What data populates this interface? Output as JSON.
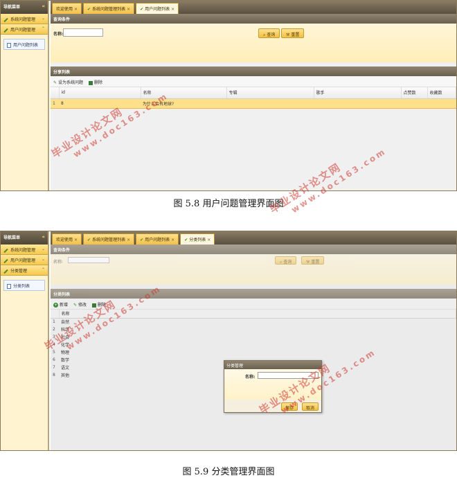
{
  "figure1": {
    "caption": "图 5.8 用户问题管理界面图",
    "sidebar": {
      "title": "导航菜单",
      "groups": [
        "系统问题管理",
        "用户问题管理"
      ],
      "items": [
        "用户问题列表"
      ]
    },
    "tabs": [
      "欢迎使用",
      "系统问题管理列表",
      "用户问题列表"
    ],
    "query": {
      "header": "查询条件",
      "name_label": "名称:",
      "search_label": "查询",
      "reset_label": "重置"
    },
    "list": {
      "header": "分享列表",
      "toolbar": [
        "设为系统问题",
        "删除"
      ],
      "columns": [
        "id",
        "名称",
        "专辑",
        "歌手",
        "点赞数",
        "收藏数"
      ],
      "rows": [
        {
          "num": "1",
          "id": "8",
          "name": "为什么会有地球?"
        }
      ]
    }
  },
  "figure2": {
    "caption": "图 5.9 分类管理界面图",
    "sidebar": {
      "title": "导航菜单",
      "groups": [
        "系统问题管理",
        "用户问题管理",
        "分类管理"
      ],
      "items": [
        "分类列表"
      ]
    },
    "tabs": [
      "欢迎使用",
      "系统问题管理列表",
      "用户问题列表",
      "分类列表"
    ],
    "query": {
      "header": "查询条件",
      "name_label": "名称:",
      "search_label": "查询",
      "reset_label": "重置"
    },
    "list": {
      "header": "分类列表",
      "toolbar": [
        "新增",
        "修改",
        "删除"
      ],
      "columns": [
        "名称"
      ],
      "rows": [
        {
          "num": "1",
          "name": "自然"
        },
        {
          "num": "2",
          "name": "科学"
        },
        {
          "num": "3",
          "name": "社会"
        },
        {
          "num": "4",
          "name": "化学"
        },
        {
          "num": "5",
          "name": "物理"
        },
        {
          "num": "6",
          "name": "数学"
        },
        {
          "num": "7",
          "name": "语文"
        },
        {
          "num": "8",
          "name": "其他"
        }
      ]
    },
    "dialog": {
      "title": "分类管理",
      "name_label": "名称:",
      "save_label": "保存",
      "cancel_label": "取消"
    }
  },
  "watermark": {
    "cn": "毕业设计论文网",
    "en": "www.doc163.com"
  }
}
